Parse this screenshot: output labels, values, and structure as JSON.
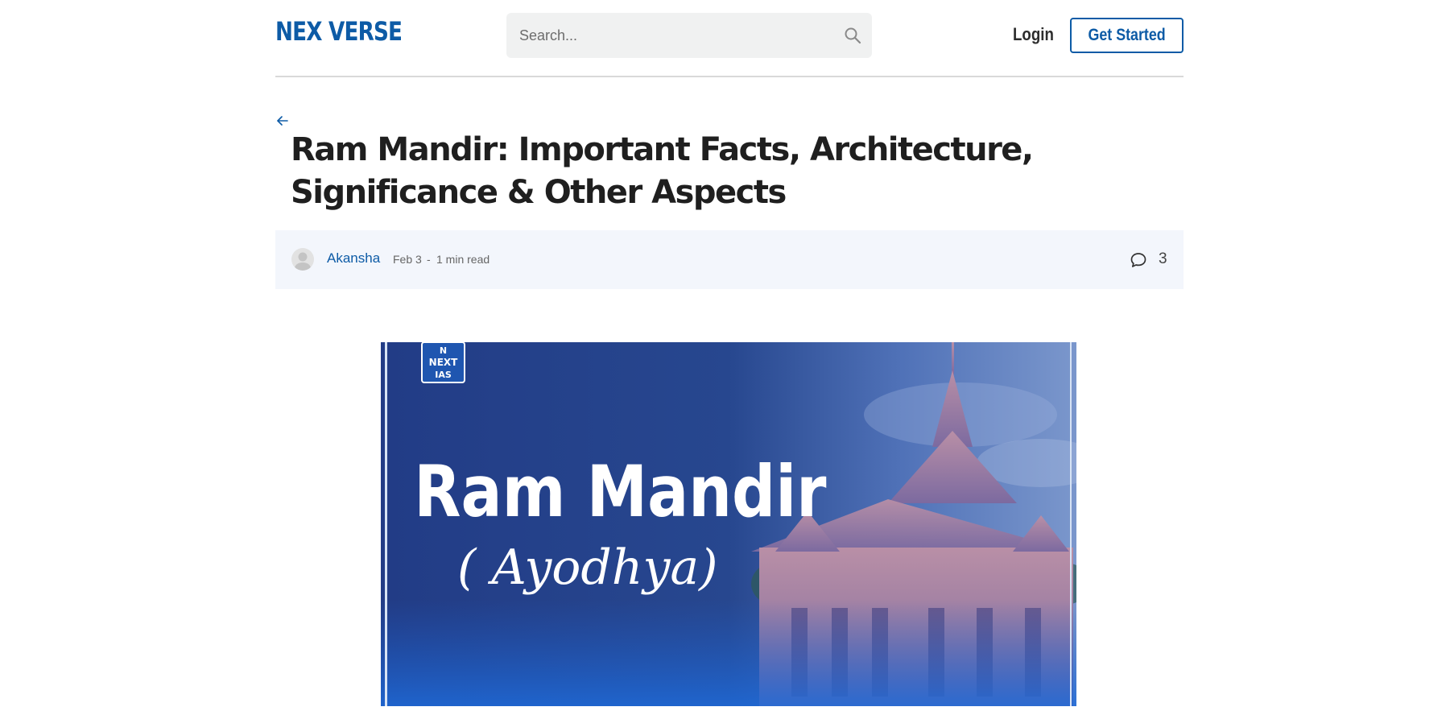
{
  "header": {
    "logo": "NEX VERSE",
    "search_placeholder": "Search...",
    "login_label": "Login",
    "get_started_label": "Get Started"
  },
  "article": {
    "title": "Ram Mandir: Important Facts, Architecture, Significance & Other Aspects",
    "author": "Akansha",
    "date": "Feb 3",
    "separator": "-",
    "read_time": "1 min read",
    "comment_count": "3"
  },
  "hero_image": {
    "badge_line1": "N",
    "badge_line2": "NEXT",
    "badge_line3": "IAS",
    "headline": "Ram Mandir",
    "subline": "( Ayodhya)"
  },
  "colors": {
    "brand": "#0d5ba6",
    "meta_bg": "#f3f6fc",
    "title": "#1f1f1f"
  },
  "icons": [
    "search-icon",
    "back-arrow-icon",
    "avatar-icon",
    "comment-icon"
  ]
}
